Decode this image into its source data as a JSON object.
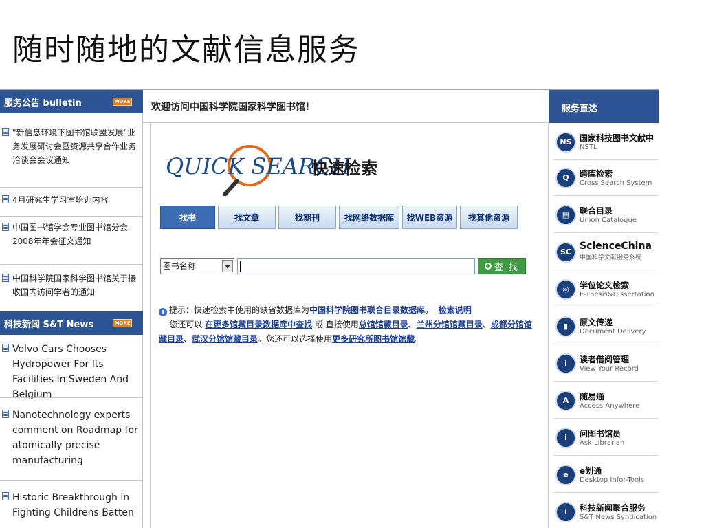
{
  "slide_title": "随时随地的文献信息服务",
  "left": {
    "bulletin": {
      "label": "服务公告 bulletin",
      "more": "MORE"
    },
    "bulletin_items": [
      "\"新信息环境下图书馆联盟发展\"业务发展研讨会暨资源共享合作业务洽谈会会议通知",
      "4月研究生学习室培训内容",
      "中国图书馆学会专业图书馆分会2008年年会征文通知",
      "中国科学院国家科学图书馆关于接收国内访问学者的通知"
    ],
    "news": {
      "label": "科技新闻 S&T News",
      "more": "MORE"
    },
    "news_items": [
      "Volvo Cars Chooses Hydropower For Its Facilities In Sweden And Belgium",
      "Nanotechnology experts comment on Roadmap for atomically precise manufacturing",
      "Historic Breakthrough in Fighting Childrens Batten"
    ]
  },
  "main": {
    "welcome": "欢迎访问中国科学院国家科学图书馆!",
    "logo_en": "QUICK SEARCH",
    "logo_cn": "快速检索",
    "tabs": [
      "找书",
      "找文章",
      "找期刊",
      "找网络数据库",
      "找WEB资源",
      "找其他资源"
    ],
    "search": {
      "field_selected": "图书名称",
      "query_value": "",
      "button_label": "查 找"
    },
    "hint": {
      "prefix": "提示：快速检索中使用的缺省数据库为",
      "default_db": "中国科学院图书联合目录数据库",
      "sep": "。",
      "help_link": "检索说明",
      "line2_prefix": "您还可以",
      "more_catalogs": "在更多馆藏目录数据库中查找",
      "or_direct": "或 直接使用",
      "cat_main": "总馆馆藏目录",
      "comma1": "、",
      "cat_lanzhou": "兰州分馆馆藏目录",
      "comma2": "、",
      "cat_chengdu": "成都分馆馆藏目录",
      "comma3": "、",
      "cat_wuhan": "武汉分馆馆藏目录",
      "choose": "。您还可以选择使用",
      "more_institutes": "更多研究所图书馆馆藏",
      "end": "。"
    }
  },
  "right": {
    "header": "服务直达",
    "services": [
      {
        "title": "国家科技图书文献中",
        "subtitle": "NSTL",
        "icon": "nstl-icon",
        "glyph": "NS"
      },
      {
        "title": "跨库检索",
        "subtitle": "Cross Search System",
        "icon": "cross-search-icon",
        "glyph": "Q"
      },
      {
        "title": "联合目录",
        "subtitle": "Union Catalogue",
        "icon": "union-catalogue-icon",
        "glyph": "▤"
      },
      {
        "title": "ScienceChina",
        "subtitle": "中国科学文献服务系统",
        "icon": "sciencechina-icon",
        "glyph": "SC"
      },
      {
        "title": "学位论文检索",
        "subtitle": "E-Thesis&Dissertation",
        "icon": "thesis-icon",
        "glyph": "◎"
      },
      {
        "title": "原文传递",
        "subtitle": "Document Delivery",
        "icon": "document-delivery-icon",
        "glyph": "▮"
      },
      {
        "title": "读者借阅管理",
        "subtitle": "View Your Record",
        "icon": "reader-icon",
        "glyph": "i"
      },
      {
        "title": "随易通",
        "subtitle": "Access Anywhere",
        "icon": "access-anywhere-icon",
        "glyph": "A"
      },
      {
        "title": "问图书馆员",
        "subtitle": "Ask Librarian",
        "icon": "ask-librarian-icon",
        "glyph": "i"
      },
      {
        "title": "e划通",
        "subtitle": "Desktop Infor-Tools",
        "icon": "desktop-tools-icon",
        "glyph": "e"
      },
      {
        "title": "科技新闻聚合服务",
        "subtitle": "S&T News Syndication",
        "icon": "news-syndication-icon",
        "glyph": "i"
      }
    ]
  }
}
